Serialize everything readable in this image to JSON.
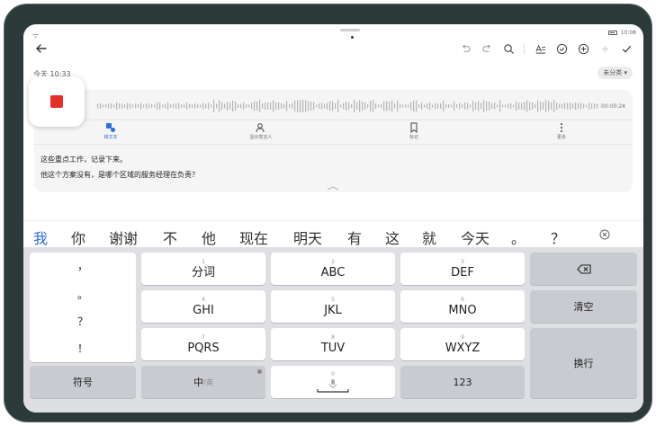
{
  "status": {
    "signal": "ᯤ",
    "time": "10:08"
  },
  "note": {
    "date": "今天 10:33",
    "category": "未分类 ▾",
    "duration": "00:00:24",
    "lines": [
      "这些重点工作，记录下来。",
      "他这个方案没有，是哪个区域的服务经理在负责？"
    ]
  },
  "actions": [
    {
      "label": "转文本",
      "icon": "transcribe-icon"
    },
    {
      "label": "显示发言人",
      "icon": "speaker-icon"
    },
    {
      "label": "标记",
      "icon": "bookmark-icon"
    },
    {
      "label": "更多",
      "icon": "more-icon"
    }
  ],
  "candidates": [
    "我",
    "你",
    "谢谢",
    "不",
    "他",
    "现在",
    "明天",
    "有",
    "这",
    "就",
    "今天",
    "。",
    "？"
  ],
  "keyboard": {
    "punct": [
      "，",
      "。",
      "？",
      "！"
    ],
    "k1": {
      "num": "1",
      "label": "分词"
    },
    "k2": {
      "num": "2",
      "label": "ABC"
    },
    "k3": {
      "num": "3",
      "label": "DEF"
    },
    "k4": {
      "num": "4",
      "label": "GHI"
    },
    "k5": {
      "num": "5",
      "label": "JKL"
    },
    "k6": {
      "num": "6",
      "label": "MNO"
    },
    "k7": {
      "num": "7",
      "label": "PQRS"
    },
    "k8": {
      "num": "8",
      "label": "TUV"
    },
    "k9": {
      "num": "9",
      "label": "WXYZ"
    },
    "k0": {
      "num": "0"
    },
    "clear": "清空",
    "enter": "换行",
    "symbol": "符号",
    "lang_main": "中",
    "lang_sub": "/英",
    "num": "123"
  },
  "colors": {
    "accent": "#2a6fdb",
    "record": "#e5302a"
  }
}
